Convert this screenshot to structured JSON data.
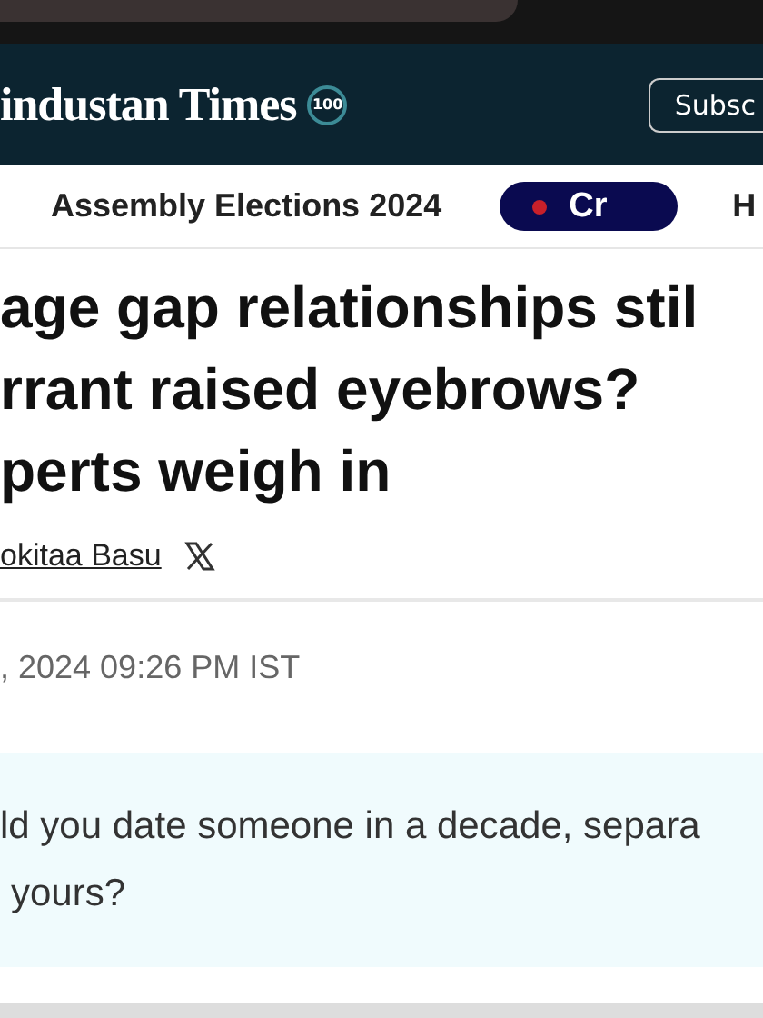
{
  "header": {
    "logo": "industan Times",
    "badge": "100",
    "subscribe": "Subsc"
  },
  "nav": {
    "items": [
      {
        "label": "Assembly Elections 2024",
        "kind": "link"
      },
      {
        "label": "Cr",
        "kind": "live"
      },
      {
        "label": "H",
        "kind": "link"
      }
    ]
  },
  "article": {
    "headline": [
      "age gap relationships stil",
      "rrant raised eyebrows?",
      "perts weigh in"
    ],
    "author": "okitaa Basu",
    "date": ", 2024 09:26 PM IST",
    "quote": [
      "ld you date someone in a decade, separa",
      "yours?"
    ]
  }
}
